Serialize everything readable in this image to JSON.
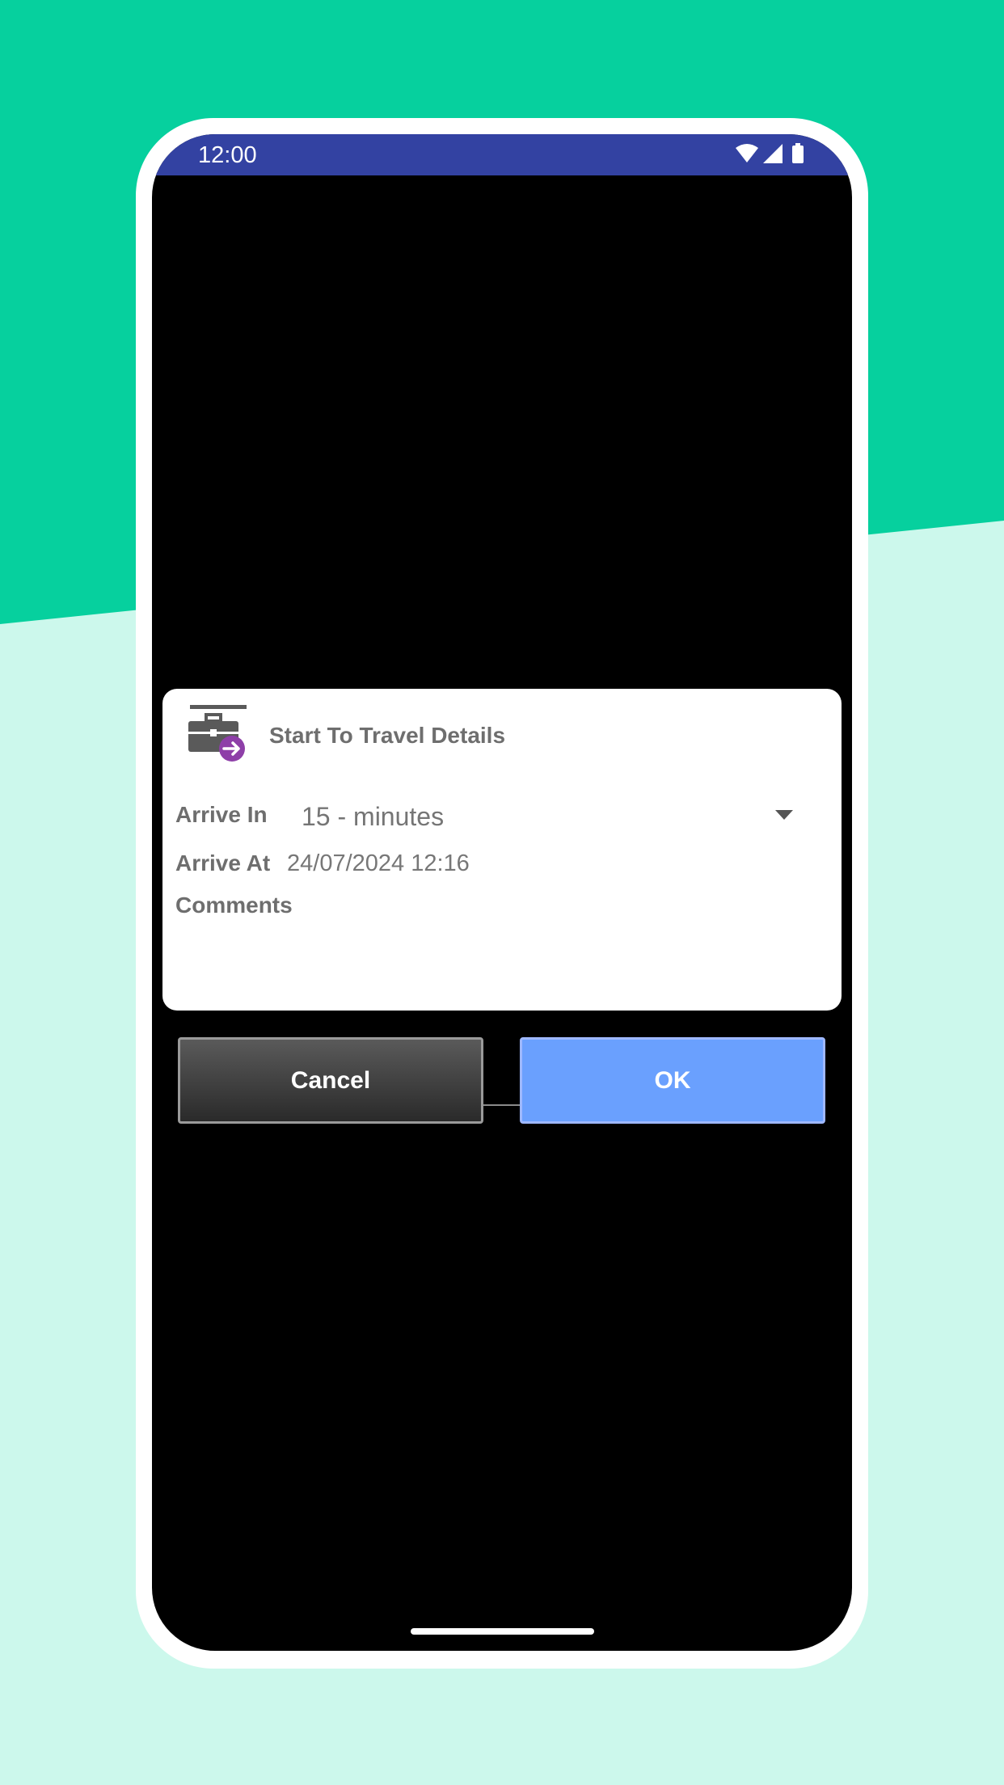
{
  "status_bar": {
    "time": "12:00",
    "icons": [
      "wifi-icon",
      "signal-icon",
      "battery-icon"
    ]
  },
  "dialog": {
    "icon": "briefcase-travel-icon",
    "title": "Start To Travel Details",
    "arrive_in_label": "Arrive In",
    "arrive_in_value": "15 - minutes",
    "arrive_at_label": "Arrive At",
    "arrive_at_value": "24/07/2024 12:16",
    "comments_label": "Comments",
    "comments_value": "",
    "comments_placeholder": ""
  },
  "buttons": {
    "cancel_label": "Cancel",
    "ok_label": "OK"
  },
  "colors": {
    "background_top": "#06d09e",
    "background_bottom": "#ccf8ec",
    "status_bar": "#3342a2",
    "ok_button": "#6aa0fe",
    "icon_accent": "#8e3fa8"
  }
}
